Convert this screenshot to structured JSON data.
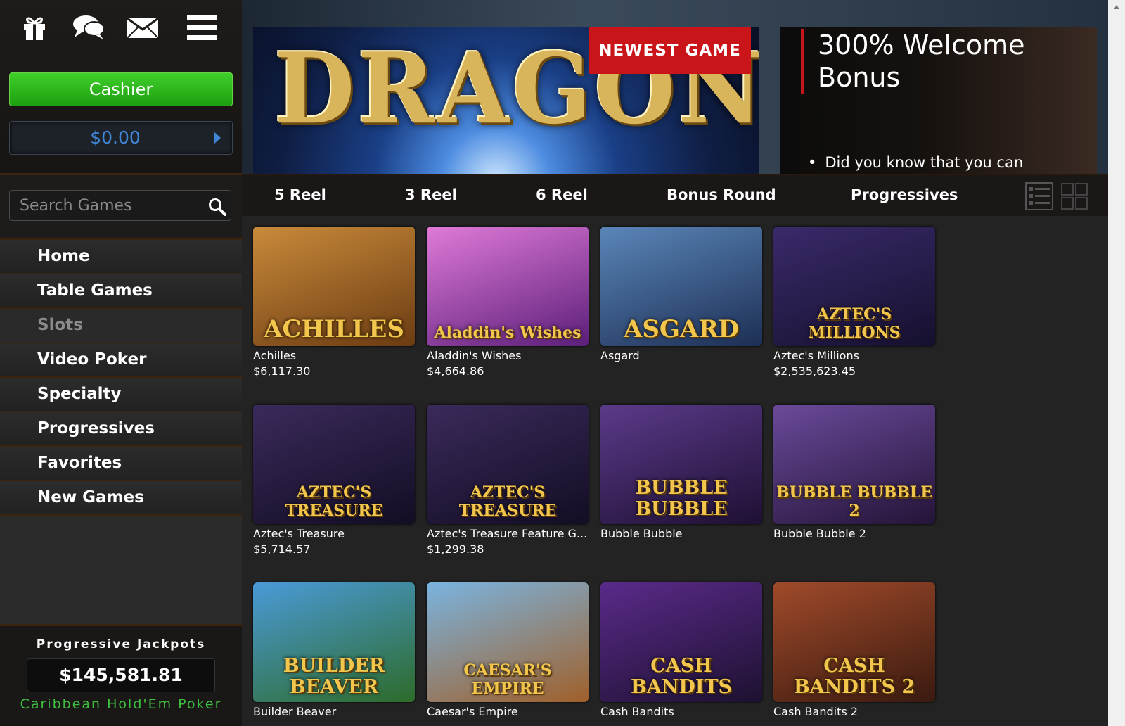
{
  "sidebar": {
    "icons": [
      "gift-icon",
      "chat-icon",
      "mail-icon",
      "menu-icon"
    ],
    "cashier_label": "Cashier",
    "balance": "$0.00",
    "search_placeholder": "Search Games",
    "nav": [
      {
        "label": "Home"
      },
      {
        "label": "Table Games"
      },
      {
        "label": "Slots",
        "active": true
      },
      {
        "label": "Video Poker"
      },
      {
        "label": "Specialty"
      },
      {
        "label": "Progressives"
      },
      {
        "label": "Favorites"
      },
      {
        "label": "New Games"
      }
    ],
    "jackpot": {
      "title": "Progressive Jackpots",
      "amount": "$145,581.81",
      "game": "Caribbean Hold'Em Poker"
    }
  },
  "banner": {
    "main_title": "DRAGON ORB",
    "badge": "NEWEST GAME",
    "side_title": "300% Welcome Bonus",
    "side_text": "Did you know that you can"
  },
  "tabs": [
    "5 Reel",
    "3 Reel",
    "6 Reel",
    "Bonus Round",
    "Progressives"
  ],
  "games": [
    {
      "name": "Achilles",
      "jackpot": "$6,117.30",
      "art": "ACHILLES",
      "bg": "#c98a3a",
      "bg2": "#6b3b12"
    },
    {
      "name": "Aladdin's Wishes",
      "jackpot": "$4,664.86",
      "art": "Aladdin's Wishes",
      "bg": "#e07ad8",
      "bg2": "#5b1f7a"
    },
    {
      "name": "Asgard",
      "jackpot": "",
      "art": "ASGARD",
      "bg": "#5a86b8",
      "bg2": "#1d2f55"
    },
    {
      "name": "Aztec's Millions",
      "jackpot": "$2,535,623.45",
      "art": "AZTEC'S MILLIONS",
      "bg": "#3a2a6a",
      "bg2": "#16102e"
    },
    {
      "name": "Aztec's Treasure",
      "jackpot": "$5,714.57",
      "art": "AZTEC'S TREASURE",
      "bg": "#3a2a5a",
      "bg2": "#130d24"
    },
    {
      "name": "Aztec's Treasure Feature G...",
      "jackpot": "$1,299.38",
      "art": "AZTEC'S TREASURE",
      "bg": "#3a2a5a",
      "bg2": "#130d24"
    },
    {
      "name": "Bubble Bubble",
      "jackpot": "",
      "art": "BUBBLE BUBBLE",
      "bg": "#5b3a8a",
      "bg2": "#1e1033"
    },
    {
      "name": "Bubble Bubble 2",
      "jackpot": "",
      "art": "BUBBLE BUBBLE 2",
      "bg": "#6a4a9a",
      "bg2": "#241438"
    },
    {
      "name": "Builder Beaver",
      "jackpot": "",
      "art": "BUILDER BEAVER",
      "bg": "#4a9ad8",
      "bg2": "#2d6b2a"
    },
    {
      "name": "Caesar's Empire",
      "jackpot": "",
      "art": "CAESAR'S EMPIRE",
      "bg": "#7ab4e0",
      "bg2": "#a0602a"
    },
    {
      "name": "Cash Bandits",
      "jackpot": "",
      "art": "CASH BANDITS",
      "bg": "#5a2a8a",
      "bg2": "#1d1130"
    },
    {
      "name": "Cash Bandits 2",
      "jackpot": "",
      "art": "CASH BANDITS 2",
      "bg": "#a04a2a",
      "bg2": "#3a1a10"
    }
  ],
  "colors": {
    "cashier_green": "#2fbf1f",
    "balance_blue": "#3f87d6",
    "badge_red": "#c9151a",
    "jackpot_green": "#3fbf3f"
  }
}
